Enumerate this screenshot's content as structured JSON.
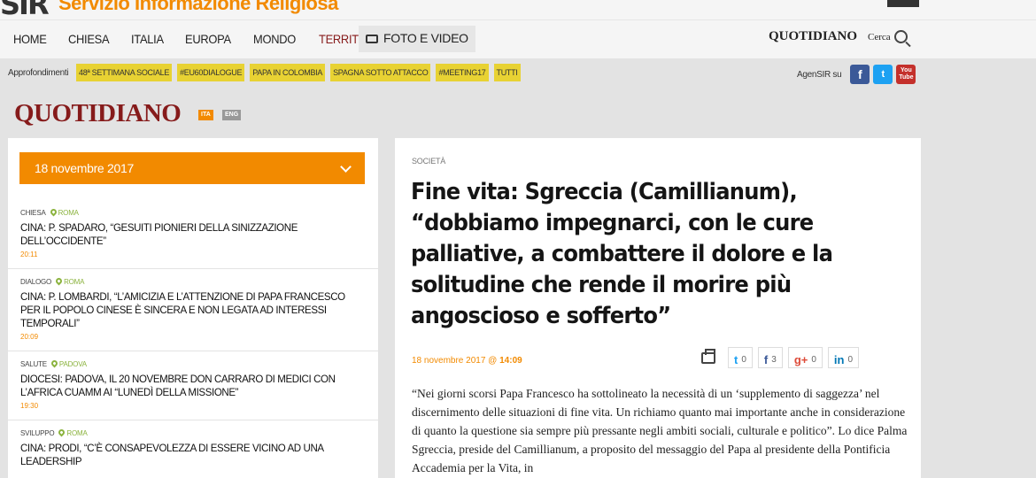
{
  "brand": {
    "logo": "SIR",
    "tagline": "Servizio Informazione Religiosa"
  },
  "nav": {
    "items": [
      "HOME",
      "CHIESA",
      "ITALIA",
      "EUROPA",
      "MONDO",
      "TERRITORI"
    ],
    "media": "FOTO E VIDEO",
    "quotidiano": "QUOTIDIANO",
    "cerca": "Cerca"
  },
  "approfondimenti": {
    "label": "Approfondimenti",
    "tags": [
      "48ª SETTIMANA SOCIALE",
      "#EU60DIALOGUE",
      "PAPA IN COLOMBIA",
      "SPAGNA SOTTO ATTACCO",
      "#MEETING17",
      "TUTTI"
    ],
    "agensir": "AgenSIR su"
  },
  "page": {
    "heading": "QUOTIDIANO",
    "lang_ita": "ITA",
    "lang_eng": "ENG"
  },
  "sidebar": {
    "date": "18 novembre 2017",
    "news": [
      {
        "cat": "CHIESA",
        "loc": "ROMA",
        "title": "CINA: P. SPADARO, “GESUITI PIONIERI DELLA SINIZZAZIONE DELL’OCCIDENTE”",
        "time": "20:11"
      },
      {
        "cat": "DIALOGO",
        "loc": "ROMA",
        "title": "CINA: P. LOMBARDI, “L’AMICIZIA E L’ATTENZIONE DI PAPA FRANCESCO PER IL POPOLO CINESE È SINCERA E NON LEGATA AD INTERESSI TEMPORALI”",
        "time": "20:09"
      },
      {
        "cat": "SALUTE",
        "loc": "PADOVA",
        "title": "DIOCESI: PADOVA, IL 20 NOVEMBRE DON CARRARO DI MEDICI CON L’AFRICA CUAMM AI “LUNEDÌ DELLA MISSIONE”",
        "time": "19:30"
      },
      {
        "cat": "SVILUPPO",
        "loc": "ROMA",
        "title": "CINA: PRODI, “C’È CONSAPEVOLEZZA DI ESSERE VICINO AD UNA LEADERSHIP",
        "time": ""
      }
    ]
  },
  "article": {
    "category": "SOCIETÀ",
    "title": "Fine vita: Sgreccia (Camillianum), “dobbiamo impegnarci, con le cure palliative, a combattere il dolore e la solitudine che rende il morire più angoscioso e sofferto”",
    "date": "18 novembre 2017 @",
    "time": "14:09",
    "share": {
      "twitter": "0",
      "facebook": "3",
      "gplus": "0",
      "linkedin": "0"
    },
    "body": "“Nei giorni scorsi Papa Francesco ha sottolineato la necessità di un ‘supplemento di saggezza’ nel discernimento delle situazioni di fine vita. Un richiamo quanto mai importante anche in considerazione di quanto la questione sia sempre più pressante negli ambiti sociali, culturale e politico”. Lo dice Palma Sgreccia, preside del Camillianum, a proposito del messaggio del Papa al presidente della Pontificia Accademia per la Vita, in"
  },
  "colors": {
    "orange": "#f28a00",
    "maroon": "#861b1b",
    "tag_yellow": "#e8d233",
    "location_green": "#8bb33e"
  }
}
